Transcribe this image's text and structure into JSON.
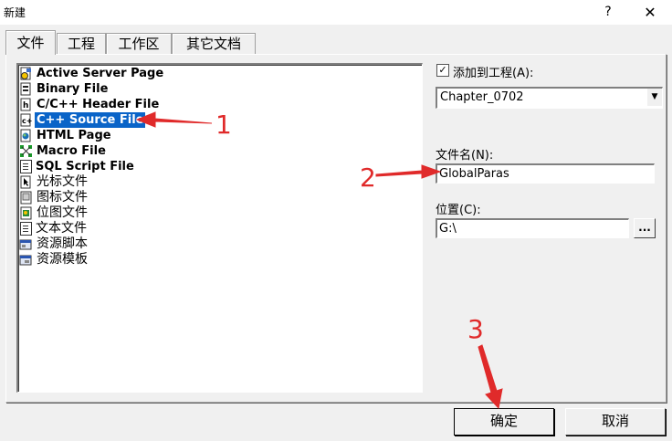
{
  "window": {
    "title": "新建",
    "help_label": "?",
    "close_label": "✕"
  },
  "tabs": [
    {
      "label": "文件",
      "active": true
    },
    {
      "label": "工程",
      "active": false
    },
    {
      "label": "工作区",
      "active": false
    },
    {
      "label": "其它文档",
      "active": false
    }
  ],
  "file_types": [
    {
      "label": "Active Server Page",
      "icon": "asp-file-icon"
    },
    {
      "label": "Binary File",
      "icon": "binary-file-icon"
    },
    {
      "label": "C/C++ Header File",
      "icon": "header-file-icon"
    },
    {
      "label": "C++ Source File",
      "icon": "cpp-source-file-icon",
      "selected": true
    },
    {
      "label": "HTML Page",
      "icon": "html-page-icon"
    },
    {
      "label": "Macro File",
      "icon": "macro-file-icon"
    },
    {
      "label": "SQL Script File",
      "icon": "sql-script-icon"
    },
    {
      "label": "光标文件",
      "icon": "cursor-file-icon"
    },
    {
      "label": "图标文件",
      "icon": "icon-file-icon"
    },
    {
      "label": "位图文件",
      "icon": "bitmap-file-icon"
    },
    {
      "label": "文本文件",
      "icon": "text-file-icon"
    },
    {
      "label": "资源脚本",
      "icon": "resource-script-icon"
    },
    {
      "label": "资源模板",
      "icon": "resource-template-icon"
    }
  ],
  "add_to_project": {
    "label": "添加到工程(A):",
    "checked": true,
    "check_glyph": "✓"
  },
  "project_combo": {
    "value": "Chapter_0702",
    "arrow": "▼"
  },
  "file_name": {
    "label": "文件名(N):",
    "value": "GlobalParas"
  },
  "location": {
    "label": "位置(C):",
    "value": "G:\\",
    "browse_label": "..."
  },
  "buttons": {
    "ok": "确定",
    "cancel": "取消"
  },
  "annotations": [
    "1",
    "2",
    "3"
  ],
  "colors": {
    "selection": "#0a64c8",
    "annotation": "#e02a2a"
  }
}
